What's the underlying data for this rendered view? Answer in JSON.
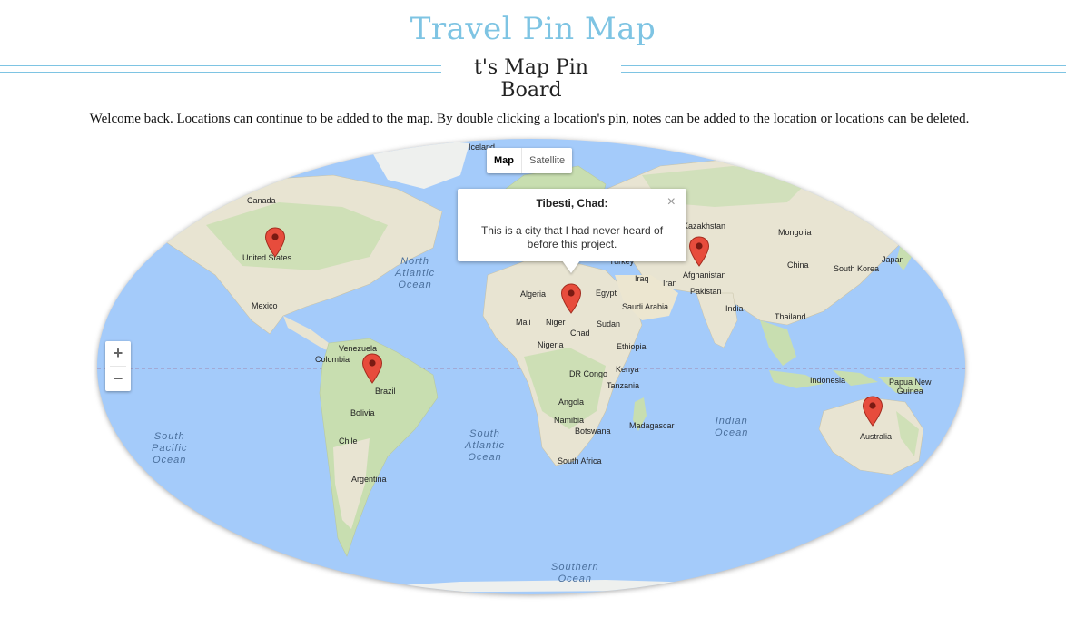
{
  "header": {
    "app_title": "Travel Pin Map",
    "board_title": "t's Map Pin Board",
    "welcome": "Welcome back. Locations can continue to be added to the map. By double clicking a location's pin, notes can be added to the location or locations can be deleted."
  },
  "map": {
    "type_control": {
      "map_label": "Map",
      "satellite_label": "Satellite",
      "selected": "Map"
    },
    "zoom": {
      "in_label": "+",
      "out_label": "−"
    },
    "infowindow": {
      "title": "Tibesti, Chad:",
      "body": "This is a city that I had never heard of before this project.",
      "close_label": "×"
    },
    "oceans": {
      "north_atlantic": "North\nAtlantic\nOcean",
      "south_atlantic": "South\nAtlantic\nOcean",
      "south_pacific": "South\nPacific\nOcean",
      "indian": "Indian\nOcean",
      "southern": "Southern\nOcean"
    },
    "labels": {
      "iceland": "Iceland",
      "canada": "Canada",
      "united_states": "United States",
      "mexico": "Mexico",
      "venezuela": "Venezuela",
      "colombia": "Colombia",
      "brazil": "Brazil",
      "bolivia": "Bolivia",
      "chile": "Chile",
      "argentina": "Argentina",
      "algeria": "Algeria",
      "mali": "Mali",
      "niger": "Niger",
      "chad": "Chad",
      "nigeria": "Nigeria",
      "egypt": "Egypt",
      "sudan": "Sudan",
      "ethiopia": "Ethiopia",
      "kenya": "Kenya",
      "dr_congo": "DR Congo",
      "tanzania": "Tanzania",
      "angola": "Angola",
      "namibia": "Namibia",
      "botswana": "Botswana",
      "madagascar": "Madagascar",
      "south_africa": "South Africa",
      "turkey": "Turkey",
      "iraq": "Iraq",
      "iran": "Iran",
      "saudi_arabia": "Saudi Arabia",
      "afghanistan": "Afghanistan",
      "pakistan": "Pakistan",
      "india": "India",
      "kazakhstan": "Kazakhstan",
      "mongolia": "Mongolia",
      "china": "China",
      "south_korea": "South Korea",
      "japan": "Japan",
      "thailand": "Thailand",
      "indonesia": "Indonesia",
      "papua_new_guinea": "Papua New\nGuinea",
      "australia": "Australia"
    },
    "pins": [
      {
        "name": "United States"
      },
      {
        "name": "Brazil"
      },
      {
        "name": "Tibesti, Chad"
      },
      {
        "name": "Afghanistan"
      },
      {
        "name": "Australia"
      }
    ],
    "colors": {
      "water": "#a4cbfa",
      "land": "#e8e4d2",
      "green": "#c8deb0",
      "pin": "#e74c3c"
    }
  }
}
